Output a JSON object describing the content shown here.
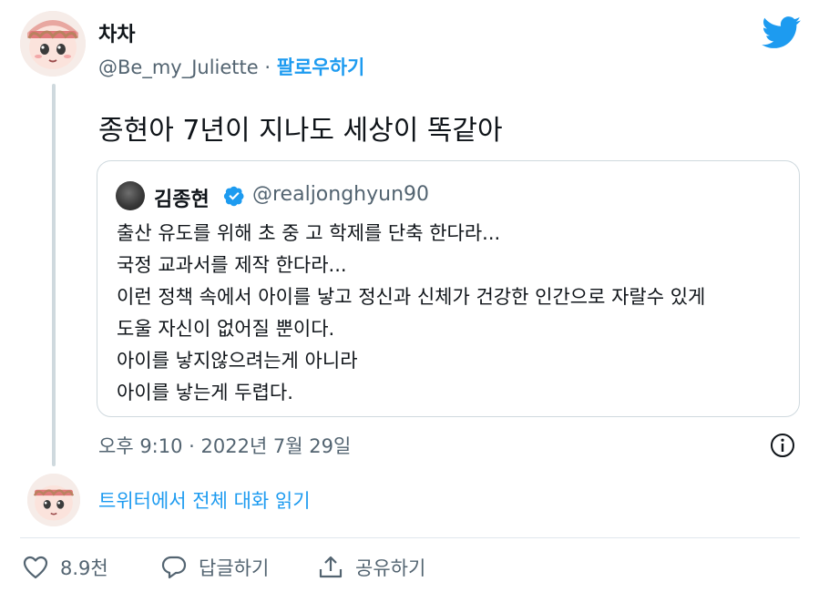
{
  "author": {
    "display_name": "차차",
    "handle": "@Be_my_Juliette",
    "separator": " · ",
    "follow_label": "팔로우하기"
  },
  "tweet": {
    "text": "종현아 7년이 지나도 세상이 똑같아",
    "timestamp": "오후 9:10 · 2022년 7월 29일"
  },
  "quoted_tweet": {
    "display_name": "김종현",
    "handle": "@realjonghyun90",
    "lines": [
      "출산 유도를 위해 초 중 고 학제를 단축 한다라...",
      "국정 교과서를 제작 한다라...",
      "이런 정책 속에서 아이를 낳고 정신과 신체가 건강한 인간으로 자랄수 있게",
      "도울 자신이 없어질 뿐이다.",
      "아이를 낳지않으려는게 아니라",
      "아이를 낳는게 두렵다."
    ]
  },
  "thread": {
    "read_label": "트위터에서 전체 대화 읽기"
  },
  "actions": {
    "like_count": "8.9천",
    "reply_label": "답글하기",
    "share_label": "공유하기"
  },
  "colors": {
    "accent": "#1d9bf0",
    "secondary_text": "#536471",
    "border": "#cfd9de"
  },
  "icons": [
    "twitter-bird-icon",
    "verified-badge-icon",
    "info-icon",
    "heart-icon",
    "reply-bubble-icon",
    "share-icon"
  ]
}
